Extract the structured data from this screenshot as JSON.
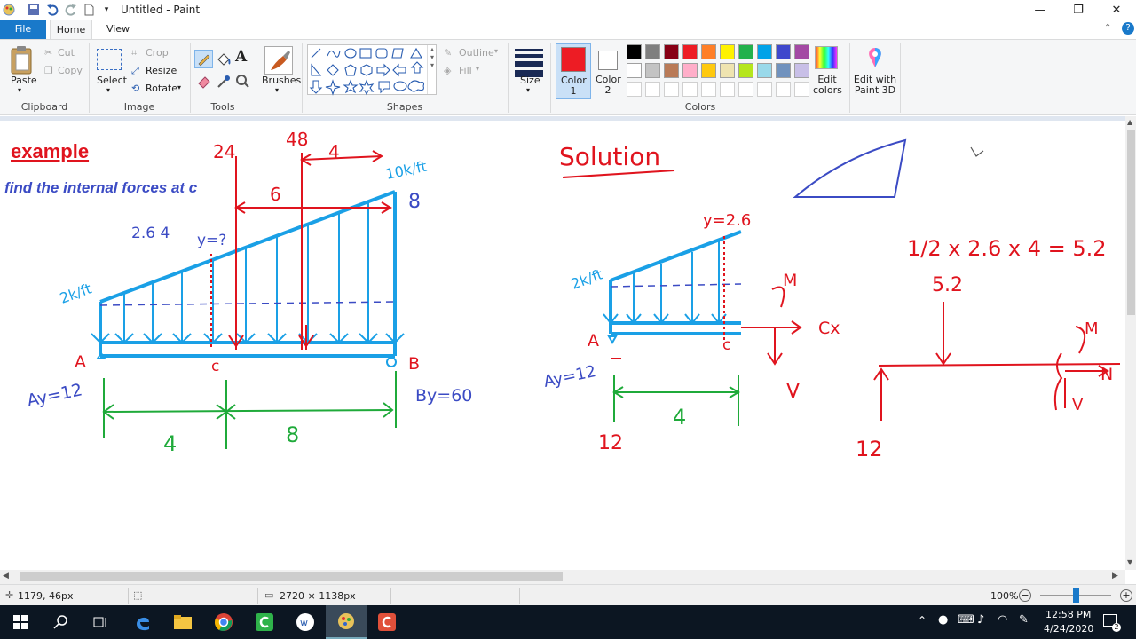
{
  "window": {
    "title": "Untitled - Paint",
    "controls": {
      "minimize": "—",
      "maximize": "❐",
      "close": "✕"
    }
  },
  "tabs": [
    {
      "label": "File"
    },
    {
      "label": "Home"
    },
    {
      "label": "View"
    }
  ],
  "clipboard": {
    "paste": "Paste",
    "cut": "Cut",
    "copy": "Copy",
    "group": "Clipboard"
  },
  "image": {
    "select": "Select",
    "crop": "Crop",
    "resize": "Resize",
    "rotate": "Rotate",
    "group": "Image"
  },
  "tools": {
    "group": "Tools"
  },
  "brushes": {
    "label": "Brushes"
  },
  "shapes": {
    "outline": "Outline",
    "fill": "Fill",
    "group": "Shapes"
  },
  "size": {
    "label": "Size"
  },
  "colors": {
    "color1_label": "Color 1",
    "color2_label": "Color 2",
    "color1": "#ed1c24",
    "color2": "#ffffff",
    "edit_colors": "Edit colors",
    "edit_3d": "Edit with Paint 3D",
    "group": "Colors",
    "palette_row1": [
      "#000000",
      "#7f7f7f",
      "#880015",
      "#ed1c24",
      "#ff7f27",
      "#fff200",
      "#22b14c",
      "#00a2e8",
      "#3f48cc",
      "#a349a4"
    ],
    "palette_row2": [
      "#ffffff",
      "#c3c3c3",
      "#b97a57",
      "#ffaec9",
      "#ffc90e",
      "#efe4b0",
      "#b5e61d",
      "#99d9ea",
      "#7092be",
      "#c8bfe7"
    ]
  },
  "drawing": {
    "example_title": "example",
    "subtitle": "find the internal forces at c",
    "hand_left": {
      "l24": "24",
      "l48": "48",
      "l4top": "4",
      "l10k": "10k/ft",
      "l6": "6",
      "l8": "8",
      "l26": "2.6 4",
      "ly": "y=?",
      "l2k": "2k/ft",
      "lA": "A",
      "lC": "c",
      "lB": "B",
      "lAy": "Ay=12",
      "lBy": "By=60",
      "dim4": "4",
      "dim8": "8"
    },
    "hand_right": {
      "solution": "Solution",
      "ly26": "y=2.6",
      "l2k": "2k/ft",
      "lA": "A",
      "lc": "c",
      "lAy": "Ay=12",
      "lM": "M",
      "lCx": "Cx",
      "lV": "V",
      "dim4": "4",
      "l12": "12",
      "eq": "1/2 x 2.6 x 4 = 5.2",
      "l52": "5.2",
      "lM2": "M",
      "lN": "N",
      "lV2": "V",
      "l12b": "12"
    }
  },
  "status": {
    "cursor_pos": "1179, 46px",
    "image_size": "2720 × 1138px",
    "zoom": "100%"
  },
  "taskbar": {
    "time": "12:58 PM",
    "date": "4/24/2020"
  }
}
